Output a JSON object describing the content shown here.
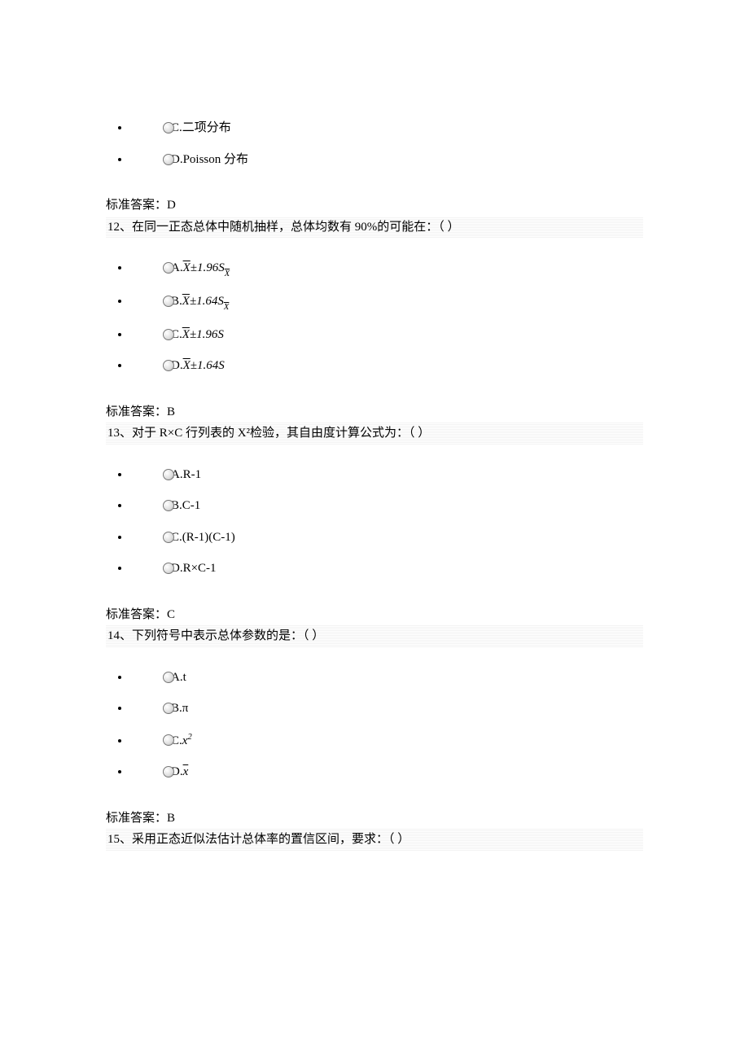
{
  "q11": {
    "options": {
      "C": "C.二项分布",
      "D": "D.Poisson 分布"
    },
    "answer_label": "标准答案：",
    "answer_value": "D"
  },
  "q12": {
    "question": "12、在同一正态总体中随机抽样，总体均数有 90%的可能在：（   ）",
    "options": {
      "A_pre": "A.",
      "A_sym": "X",
      "A_mid": "±1.96",
      "A_s": "S",
      "A_sub": "X",
      "B_pre": "B.",
      "B_sym": "X",
      "B_mid": "±1.64",
      "B_s": "S",
      "B_sub": "X",
      "C_pre": "C.",
      "C_sym": "X",
      "C_mid": "±1.96",
      "C_s": "S",
      "D_pre": "D.",
      "D_sym": "X",
      "D_mid": "±1.64",
      "D_s": "S"
    },
    "answer_label": "标准答案：",
    "answer_value": "B"
  },
  "q13": {
    "question": "13、对于 R×C 行列表的 X²检验，其自由度计算公式为：（    ）",
    "options": {
      "A": "A.R-1",
      "B": "B.C-1",
      "C": "C.(R-1)(C-1)",
      "D": "D.R×C-1"
    },
    "answer_label": "标准答案：",
    "answer_value": "C"
  },
  "q14": {
    "question": "14、下列符号中表示总体参数的是：（    ）",
    "options": {
      "A": "A.t",
      "B": "B.π",
      "C_pre": "C.",
      "C_sym": "x",
      "C_sup": "2",
      "D_pre": "D.",
      "D_sym": "x"
    },
    "answer_label": "标准答案：",
    "answer_value": "B"
  },
  "q15": {
    "question": "15、采用正态近似法估计总体率的置信区间，要求：（    ）"
  },
  "chart_data": {
    "type": "table",
    "note": "Document excerpt of multiple-choice statistics questions with answers",
    "items": [
      {
        "id": 11,
        "partial_options": [
          "C.二项分布",
          "D.Poisson 分布"
        ],
        "answer": "D"
      },
      {
        "id": 12,
        "q": "在同一正态总体中随机抽样，总体均数有 90%的可能在",
        "options": [
          "X̄±1.96S_X̄",
          "X̄±1.64S_X̄",
          "X̄±1.96S",
          "X̄±1.64S"
        ],
        "answer": "B"
      },
      {
        "id": 13,
        "q": "对于 R×C 行列表的 X² 检验，其自由度计算公式为",
        "options": [
          "R-1",
          "C-1",
          "(R-1)(C-1)",
          "R×C-1"
        ],
        "answer": "C"
      },
      {
        "id": 14,
        "q": "下列符号中表示总体参数的是",
        "options": [
          "t",
          "π",
          "x²",
          "x̄"
        ],
        "answer": "B"
      },
      {
        "id": 15,
        "q": "采用正态近似法估计总体率的置信区间，要求"
      }
    ]
  }
}
